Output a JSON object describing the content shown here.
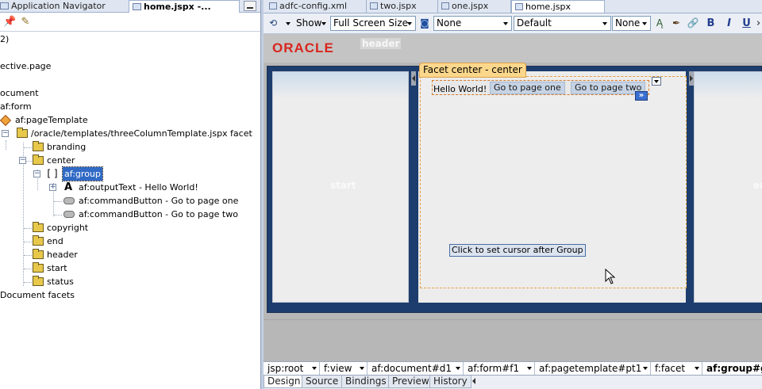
{
  "left_panel": {
    "tabs": [
      {
        "label": "Application Navigator"
      },
      {
        "label": "home.jspx -..."
      }
    ],
    "tree": [
      {
        "label": "2)"
      },
      {
        "label": "ective.page"
      },
      {
        "label": "ocument"
      },
      {
        "label": "af:form"
      },
      {
        "label": "af:pageTemplate"
      },
      {
        "label": "/oracle/templates/threeColumnTemplate.jspx facet"
      },
      {
        "label": "branding"
      },
      {
        "label": "center"
      },
      {
        "label": "af:group"
      },
      {
        "label": "af:outputText - Hello World!"
      },
      {
        "label": "af:commandButton - Go to page one"
      },
      {
        "label": "af:commandButton - Go to page two"
      },
      {
        "label": "copyright"
      },
      {
        "label": "end"
      },
      {
        "label": "header"
      },
      {
        "label": "start"
      },
      {
        "label": "status"
      },
      {
        "label": "Document facets"
      }
    ]
  },
  "editor": {
    "tabs": [
      {
        "label": "adfc-config.xml"
      },
      {
        "label": "two.jspx"
      },
      {
        "label": "one.jspx"
      },
      {
        "label": "home.jspx"
      }
    ],
    "toolbar": {
      "show_label": "Show",
      "show_select": "Full Screen Size",
      "style_select": "None",
      "class_select": "Default",
      "font_select": "None",
      "bold": "B",
      "italic": "I",
      "underline": "U"
    },
    "canvas": {
      "logo_text": "ORACLE",
      "header_label": "header",
      "start_label": "start",
      "end_label": "en",
      "facet_label": "Facet   center - center",
      "hello_text": "Hello World!",
      "button_one": "Go to page one",
      "button_two": "Go to page two",
      "more_icon_text": "»",
      "cursor_hint": "Click to set cursor after Group"
    },
    "breadcrumb": [
      {
        "label": "jsp:root"
      },
      {
        "label": "f:view"
      },
      {
        "label": "af:document#d1"
      },
      {
        "label": "af:form#f1"
      },
      {
        "label": "af:pagetemplate#pt1"
      },
      {
        "label": "f:facet"
      },
      {
        "label": "af:group#g"
      }
    ],
    "bottom_tabs": [
      {
        "label": "Design"
      },
      {
        "label": "Source"
      },
      {
        "label": "Bindings"
      },
      {
        "label": "Preview"
      },
      {
        "label": "History"
      }
    ]
  },
  "colors": {
    "selection": "#316ac5",
    "oracle_red": "#d9251d",
    "facet_orange": "#fbd78c",
    "frame_blue": "#1d3d6e"
  }
}
